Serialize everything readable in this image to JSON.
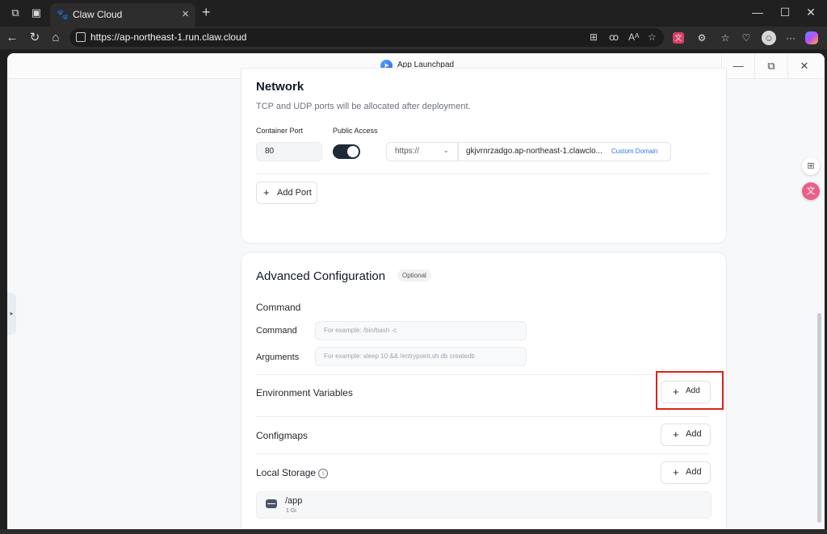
{
  "browser": {
    "tab_title": "Claw Cloud",
    "url": "https://ap-northeast-1.run.claw.cloud",
    "icons": [
      "workspaces-icon",
      "tab-actions-icon",
      "paw-favicon",
      "close-icon",
      "new-tab-icon",
      "minimize-icon",
      "maximize-icon",
      "close-window-icon",
      "back-icon",
      "refresh-icon",
      "home-icon",
      "lock-icon",
      "apps-icon",
      "read-aloud-icon",
      "text-icon",
      "favorite-icon",
      "translate-icon",
      "extensions-icon",
      "favorites-icon",
      "browser-essentials-icon",
      "profile-avatar",
      "more-icon",
      "copilot-icon"
    ]
  },
  "app": {
    "title": "App Launchpad",
    "header_buttons": [
      "minimize",
      "restore",
      "close"
    ]
  },
  "network": {
    "title": "Network",
    "subtitle": "TCP and UDP ports will be allocated after deployment.",
    "container_port_label": "Container Port",
    "public_access_label": "Public Access",
    "port_value": "80",
    "public_access_enabled": true,
    "protocol": "https://",
    "domain": "gkjvrnrzadgo.ap-northeast-1.clawclo...",
    "custom_domain_label": "Custom Domain",
    "add_port_label": "Add Port"
  },
  "advanced": {
    "title": "Advanced Configuration",
    "optional_badge": "Optional",
    "command_section": "Command",
    "command_label": "Command",
    "command_placeholder": "For example:  /bin/bash -c",
    "arguments_label": "Arguments",
    "arguments_placeholder": "For example:  sleep 10 && /entrypoint.sh db createdb",
    "env_vars_label": "Environment Variables",
    "configmaps_label": "Configmaps",
    "local_storage_label": "Local Storage",
    "add_label": "Add",
    "storage": {
      "path": "/app",
      "size": "1 Gi"
    }
  },
  "colors": {
    "highlight": "#e0201a",
    "switch_on": "#1f2937",
    "link": "#2b78e4"
  }
}
